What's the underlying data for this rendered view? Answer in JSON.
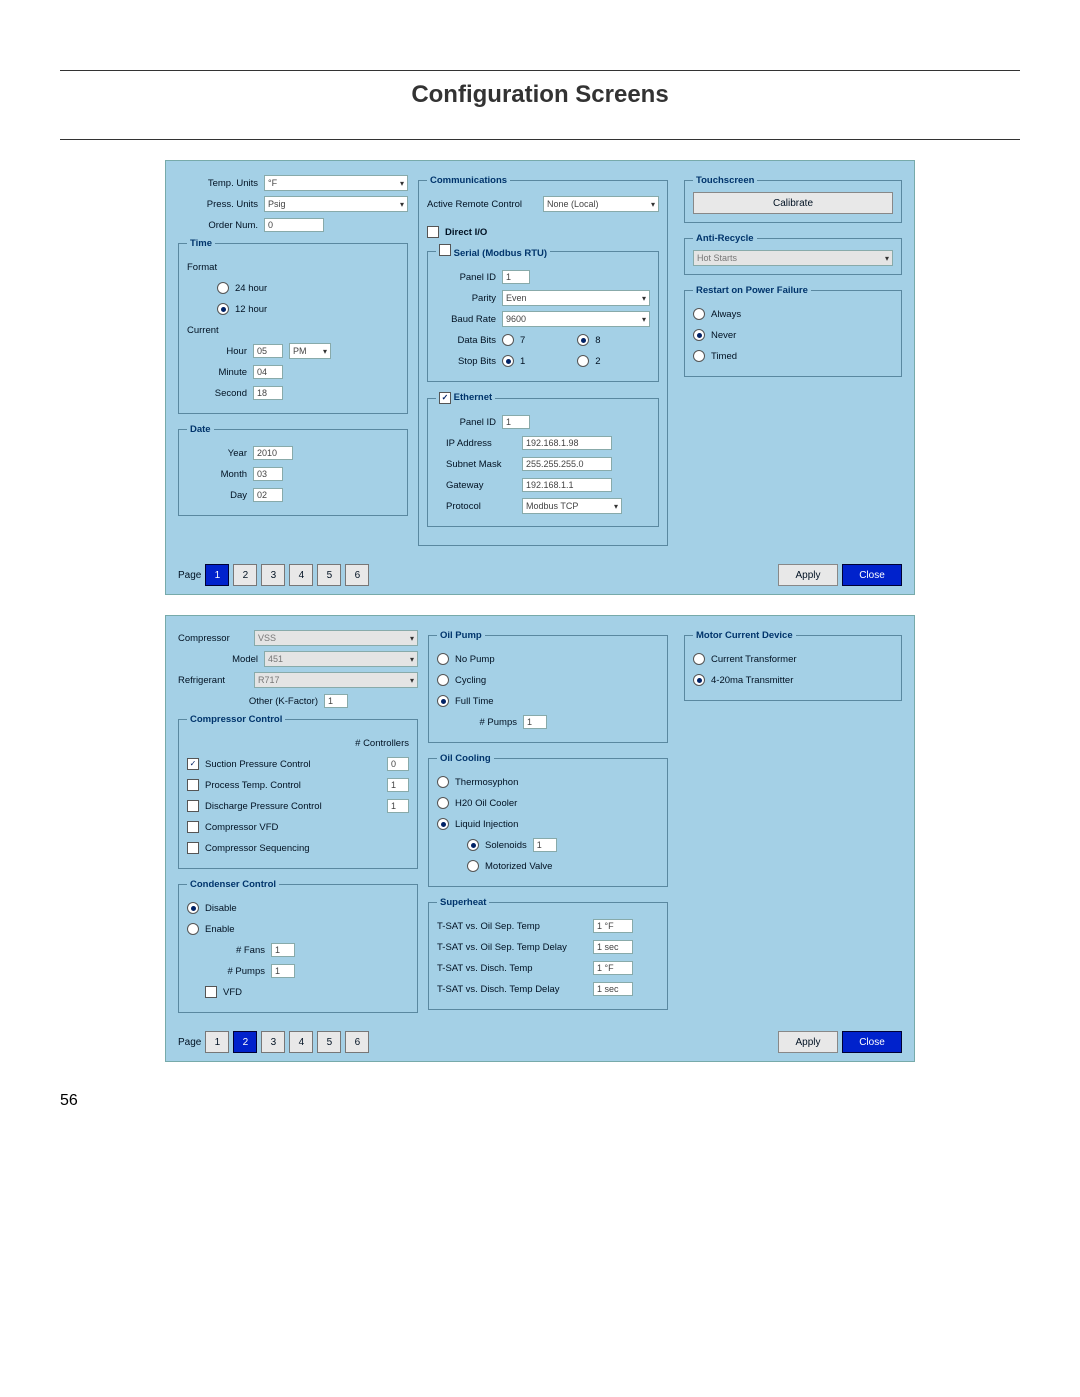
{
  "title": "Configuration Screens",
  "page_number": "56",
  "panel1": {
    "temp_units_label": "Temp. Units",
    "temp_units_value": "°F",
    "press_units_label": "Press. Units",
    "press_units_value": "Psig",
    "order_num_label": "Order Num.",
    "order_num_value": "0",
    "time_legend": "Time",
    "format_label": "Format",
    "hr24": "24 hour",
    "hr12": "12 hour",
    "current_label": "Current",
    "hour_label": "Hour",
    "hour_value": "05",
    "ampm": "PM",
    "minute_label": "Minute",
    "minute_value": "04",
    "second_label": "Second",
    "second_value": "18",
    "date_legend": "Date",
    "year_label": "Year",
    "year_value": "2010",
    "month_label": "Month",
    "month_value": "03",
    "day_label": "Day",
    "day_value": "02",
    "comm_legend": "Communications",
    "arc_label": "Active Remote Control",
    "arc_value": "None (Local)",
    "direct_io": "Direct I/O",
    "serial_legend": "Serial (Modbus RTU)",
    "panel_id_label": "Panel ID",
    "panel_id_value": "1",
    "parity_label": "Parity",
    "parity_value": "Even",
    "baud_label": "Baud Rate",
    "baud_value": "9600",
    "databits_label": "Data Bits",
    "databits_7": "7",
    "databits_8": "8",
    "stopbits_label": "Stop Bits",
    "stopbits_1": "1",
    "stopbits_2": "2",
    "eth_legend": "Ethernet",
    "eth_panel_id_value": "1",
    "ip_label": "IP Address",
    "ip_value": "192.168.1.98",
    "subnet_label": "Subnet Mask",
    "subnet_value": "255.255.255.0",
    "gateway_label": "Gateway",
    "gateway_value": "192.168.1.1",
    "protocol_label": "Protocol",
    "protocol_value": "Modbus TCP",
    "touch_legend": "Touchscreen",
    "calibrate": "Calibrate",
    "anti_legend": "Anti-Recycle",
    "anti_value": "Hot Starts",
    "restart_legend": "Restart on Power Failure",
    "always": "Always",
    "never": "Never",
    "timed": "Timed",
    "page_label": "Page",
    "pages": [
      "1",
      "2",
      "3",
      "4",
      "5",
      "6"
    ],
    "active_page": "1",
    "apply": "Apply",
    "close": "Close"
  },
  "panel2": {
    "compressor_label": "Compressor",
    "compressor_value": "VSS",
    "model_label": "Model",
    "model_value": "451",
    "refrigerant_label": "Refrigerant",
    "refrigerant_value": "R717",
    "other_label": "Other (K-Factor)",
    "other_value": "1",
    "compctrl_legend": "Compressor Control",
    "numctrl_label": "# Controllers",
    "spc": "Suction Pressure Control",
    "spc_val": "0",
    "ptc": "Process Temp. Control",
    "ptc_val": "1",
    "dpc": "Discharge Pressure Control",
    "dpc_val": "1",
    "vfd": "Compressor VFD",
    "seq": "Compressor Sequencing",
    "cond_legend": "Condenser Control",
    "disable": "Disable",
    "enable": "Enable",
    "fans_label": "# Fans",
    "fans_value": "1",
    "pumps_label": "# Pumps",
    "pumps_value": "1",
    "vfd2": "VFD",
    "oilpump_legend": "Oil Pump",
    "nopump": "No Pump",
    "cycling": "Cycling",
    "fulltime": "Full Time",
    "pumps2_label": "# Pumps",
    "pumps2_value": "1",
    "oilcool_legend": "Oil Cooling",
    "thermo": "Thermosyphon",
    "h2o": "H20 Oil Cooler",
    "liquid": "Liquid Injection",
    "solenoids": "Solenoids",
    "solenoids_value": "1",
    "motorized": "Motorized Valve",
    "superheat_legend": "Superheat",
    "sh1_label": "T-SAT vs. Oil Sep. Temp",
    "sh1_value": "1 °F",
    "sh2_label": "T-SAT vs. Oil Sep. Temp Delay",
    "sh2_value": "1 sec",
    "sh3_label": "T-SAT vs. Disch. Temp",
    "sh3_value": "1 °F",
    "sh4_label": "T-SAT vs. Disch. Temp Delay",
    "sh4_value": "1 sec",
    "motor_legend": "Motor Current Device",
    "ct": "Current Transformer",
    "trans420": "4-20ma  Transmitter",
    "page_label": "Page",
    "pages": [
      "1",
      "2",
      "3",
      "4",
      "5",
      "6"
    ],
    "active_page": "2",
    "apply": "Apply",
    "close": "Close"
  }
}
